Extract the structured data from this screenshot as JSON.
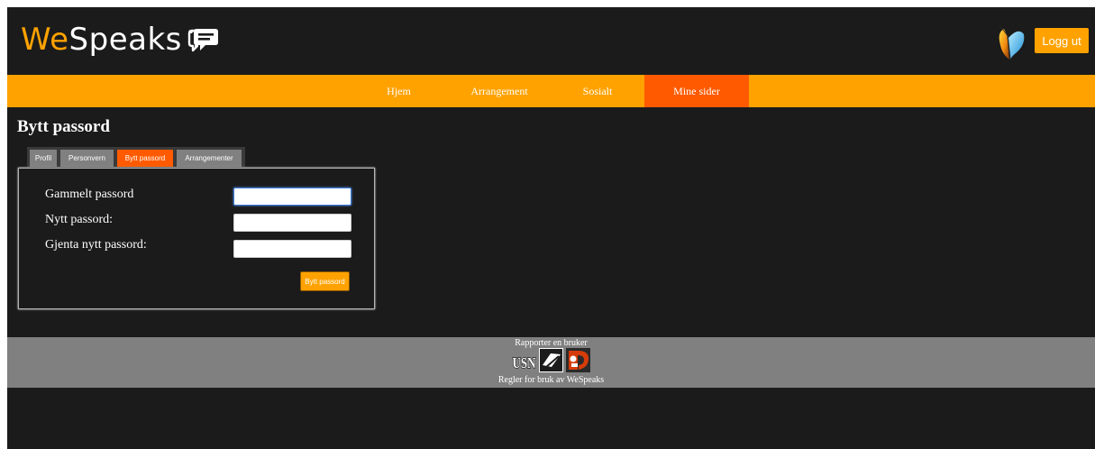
{
  "header": {
    "logo_we": "We",
    "logo_speaks": "Speaks",
    "logout_label": "Logg ut"
  },
  "nav": [
    {
      "label": "Hjem"
    },
    {
      "label": "Arrangement"
    },
    {
      "label": "Sosialt"
    },
    {
      "label": "Mine sider",
      "active": true
    }
  ],
  "page_title": "Bytt passord",
  "tabs": [
    {
      "label": "Profil"
    },
    {
      "label": "Personvern"
    },
    {
      "label": "Bytt passord",
      "active": true
    },
    {
      "label": "Arrangementer"
    }
  ],
  "form": {
    "fields": [
      {
        "label": "Gammelt passord",
        "value": ""
      },
      {
        "label": "Nytt passord:",
        "value": ""
      },
      {
        "label": "Gjenta nytt passord:",
        "value": ""
      }
    ],
    "submit_label": "Bytt passord"
  },
  "footer": {
    "report_link": "Rapporter en bruker",
    "rules_link": "Regler for bruk av WeSpeaks",
    "logo_usn": "USN"
  },
  "colors": {
    "accent": "#ffa200",
    "active": "#ff5a00",
    "background": "#1b1b1b",
    "footer": "#808080"
  }
}
